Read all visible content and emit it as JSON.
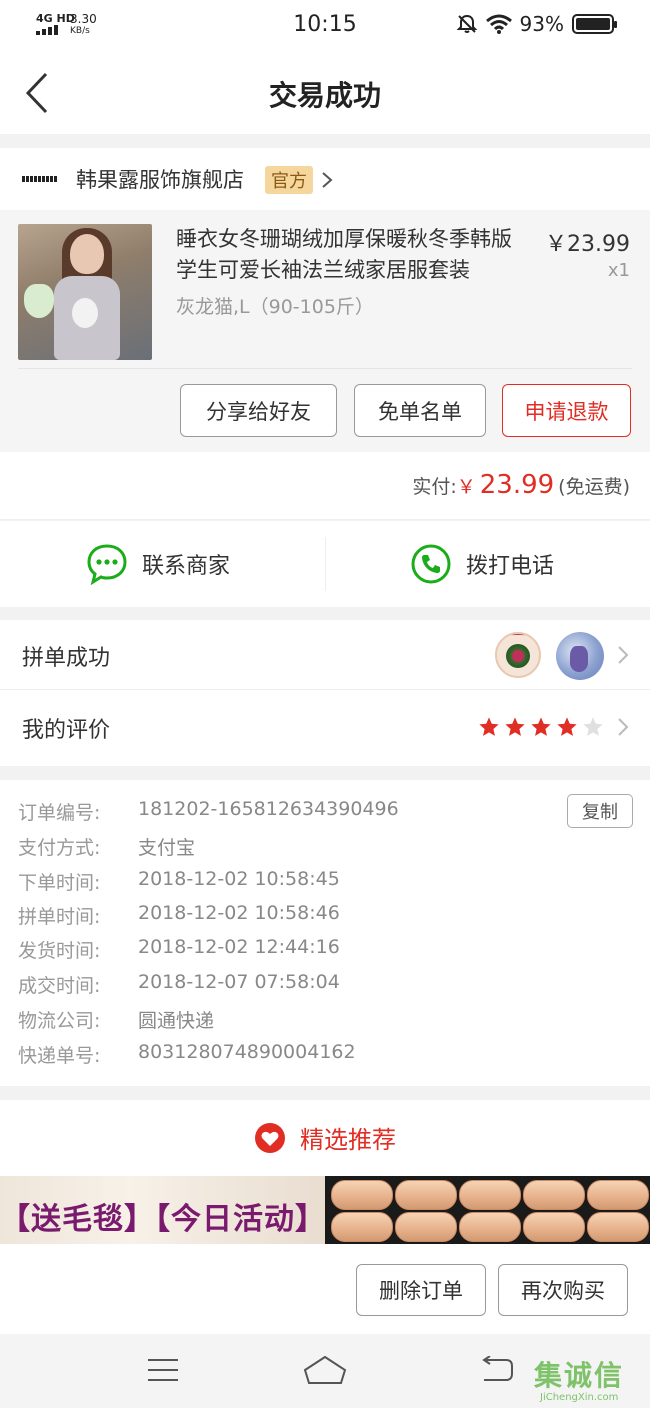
{
  "status_bar": {
    "network": "4G HD",
    "speed": "3.30",
    "speed_unit": "KB/s",
    "time": "10:15",
    "battery": "93%"
  },
  "nav": {
    "title": "交易成功"
  },
  "store": {
    "name": "韩果露服饰旗舰店",
    "badge": "官方"
  },
  "product": {
    "title": "睡衣女冬珊瑚绒加厚保暖秋冬季韩版学生可爱长袖法兰绒家居服套装",
    "variant": "灰龙猫,L（90-105斤）",
    "price": "￥23.99",
    "quantity": "x1",
    "buttons": {
      "share": "分享给好友",
      "free_list": "免单名单",
      "refund": "申请退款"
    }
  },
  "payment": {
    "label": "实付:",
    "currency": "￥",
    "amount": "23.99",
    "shipping": "(免运费)"
  },
  "contact": {
    "merchant": "联系商家",
    "call": "拨打电话"
  },
  "group_buy": {
    "label": "拼单成功"
  },
  "review": {
    "label": "我的评价",
    "rating": 4,
    "max": 5
  },
  "order_details": {
    "copy_label": "复制",
    "rows": [
      {
        "label": "订单编号:",
        "value": "181202-165812634390496"
      },
      {
        "label": "支付方式:",
        "value": "支付宝"
      },
      {
        "label": "下单时间:",
        "value": "2018-12-02 10:58:45"
      },
      {
        "label": "拼单时间:",
        "value": "2018-12-02 10:58:46"
      },
      {
        "label": "发货时间:",
        "value": "2018-12-02 12:44:16"
      },
      {
        "label": "成交时间:",
        "value": "2018-12-07 07:58:04"
      },
      {
        "label": "物流公司:",
        "value": "圆通快递"
      },
      {
        "label": "快递单号:",
        "value": "803128074890004162"
      }
    ]
  },
  "recommend": {
    "title": "精选推荐",
    "banner_left": "【送毛毯】【今日活动】"
  },
  "actions": {
    "delete": "删除订单",
    "rebuy": "再次购买"
  },
  "watermark": {
    "text": "集诚信",
    "sub": "JiChengXin.com"
  },
  "colors": {
    "accent": "#e02e24",
    "green": "#1aad19",
    "star": "#e02e24"
  }
}
